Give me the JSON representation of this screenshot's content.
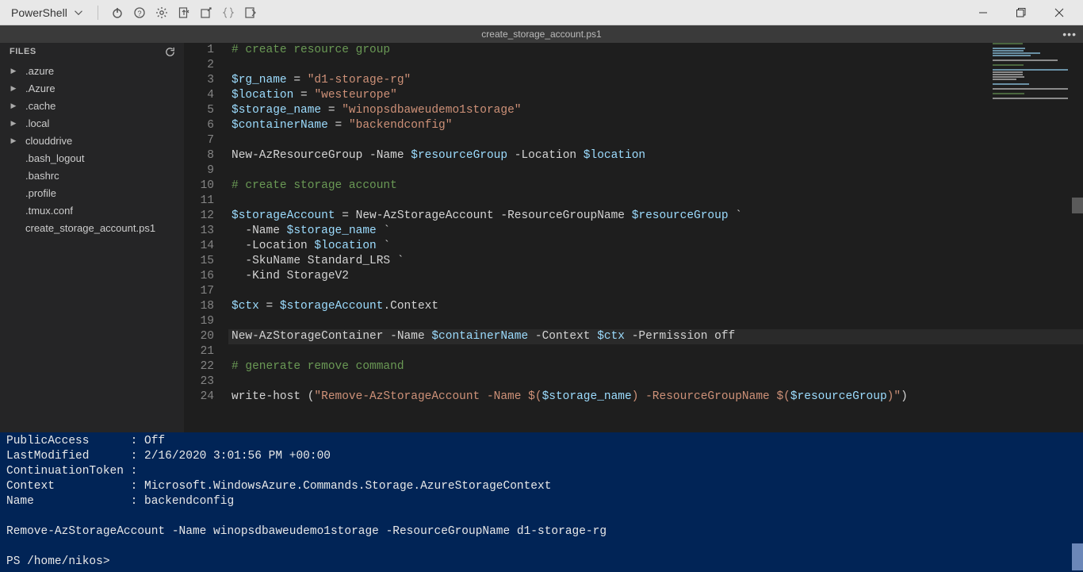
{
  "toolbar": {
    "shell_label": "PowerShell"
  },
  "tab": {
    "filename": "create_storage_account.ps1"
  },
  "sidebar": {
    "header": "FILES",
    "items": [
      {
        "kind": "folder",
        "label": ".azure"
      },
      {
        "kind": "folder",
        "label": ".Azure"
      },
      {
        "kind": "folder",
        "label": ".cache"
      },
      {
        "kind": "folder",
        "label": ".local"
      },
      {
        "kind": "folder",
        "label": "clouddrive"
      },
      {
        "kind": "file",
        "label": ".bash_logout"
      },
      {
        "kind": "file",
        "label": ".bashrc"
      },
      {
        "kind": "file",
        "label": ".profile"
      },
      {
        "kind": "file",
        "label": ".tmux.conf"
      },
      {
        "kind": "file",
        "label": "create_storage_account.ps1"
      }
    ]
  },
  "code": {
    "current_line": 20,
    "lines": [
      [
        {
          "c": "tok-comment",
          "t": "# create resource group"
        }
      ],
      [],
      [
        {
          "c": "tok-var",
          "t": "$rg_name"
        },
        {
          "c": "tok-op",
          "t": " = "
        },
        {
          "c": "tok-str",
          "t": "\"d1-storage-rg\""
        }
      ],
      [
        {
          "c": "tok-var",
          "t": "$location"
        },
        {
          "c": "tok-op",
          "t": " = "
        },
        {
          "c": "tok-str",
          "t": "\"westeurope\""
        }
      ],
      [
        {
          "c": "tok-var",
          "t": "$storage_name"
        },
        {
          "c": "tok-op",
          "t": " = "
        },
        {
          "c": "tok-str",
          "t": "\"winopsdbaweudemo1storage\""
        }
      ],
      [
        {
          "c": "tok-var",
          "t": "$containerName"
        },
        {
          "c": "tok-op",
          "t": " = "
        },
        {
          "c": "tok-str",
          "t": "\"backendconfig\""
        }
      ],
      [],
      [
        {
          "c": "tok-cmd",
          "t": "New-AzResourceGroup -Name "
        },
        {
          "c": "tok-var",
          "t": "$resourceGroup"
        },
        {
          "c": "tok-cmd",
          "t": " -Location "
        },
        {
          "c": "tok-var",
          "t": "$location"
        }
      ],
      [],
      [
        {
          "c": "tok-comment",
          "t": "# create storage account"
        }
      ],
      [],
      [
        {
          "c": "tok-var",
          "t": "$storageAccount"
        },
        {
          "c": "tok-op",
          "t": " = "
        },
        {
          "c": "tok-cmd",
          "t": "New-AzStorageAccount -ResourceGroupName "
        },
        {
          "c": "tok-var",
          "t": "$resourceGroup"
        },
        {
          "c": "tok-cmd",
          "t": " `"
        }
      ],
      [
        {
          "c": "tok-cmd",
          "t": "  -Name "
        },
        {
          "c": "tok-var",
          "t": "$storage_name"
        },
        {
          "c": "tok-cmd",
          "t": " `"
        }
      ],
      [
        {
          "c": "tok-cmd",
          "t": "  -Location "
        },
        {
          "c": "tok-var",
          "t": "$location"
        },
        {
          "c": "tok-cmd",
          "t": " `"
        }
      ],
      [
        {
          "c": "tok-cmd",
          "t": "  -SkuName Standard_LRS `"
        }
      ],
      [
        {
          "c": "tok-cmd",
          "t": "  -Kind StorageV2"
        }
      ],
      [],
      [
        {
          "c": "tok-var",
          "t": "$ctx"
        },
        {
          "c": "tok-op",
          "t": " = "
        },
        {
          "c": "tok-var",
          "t": "$storageAccount"
        },
        {
          "c": "tok-member",
          "t": ".Context"
        }
      ],
      [],
      [
        {
          "c": "tok-cmd",
          "t": "New-AzStorageContainer -Name "
        },
        {
          "c": "tok-var",
          "t": "$containerName"
        },
        {
          "c": "tok-cmd",
          "t": " -Context "
        },
        {
          "c": "tok-var",
          "t": "$ctx"
        },
        {
          "c": "tok-cmd",
          "t": " -Permission off"
        }
      ],
      [],
      [
        {
          "c": "tok-comment",
          "t": "# generate remove command"
        }
      ],
      [],
      [
        {
          "c": "tok-cmd",
          "t": "write-host ("
        },
        {
          "c": "tok-str",
          "t": "\"Remove-AzStorageAccount -Name "
        },
        {
          "c": "tok-str",
          "t": "$("
        },
        {
          "c": "tok-var",
          "t": "$storage_name"
        },
        {
          "c": "tok-str",
          "t": ")"
        },
        {
          "c": "tok-str",
          "t": " -ResourceGroupName "
        },
        {
          "c": "tok-str",
          "t": "$("
        },
        {
          "c": "tok-var",
          "t": "$resourceGroup"
        },
        {
          "c": "tok-str",
          "t": ")\""
        },
        {
          "c": "tok-cmd",
          "t": ")"
        }
      ]
    ]
  },
  "terminal": {
    "lines": [
      "PublicAccess      : Off",
      "LastModified      : 2/16/2020 3:01:56 PM +00:00",
      "ContinuationToken :",
      "Context           : Microsoft.WindowsAzure.Commands.Storage.AzureStorageContext",
      "Name              : backendconfig",
      "",
      "Remove-AzStorageAccount -Name winopsdbaweudemo1storage -ResourceGroupName d1-storage-rg",
      "",
      "PS /home/nikos>"
    ]
  }
}
